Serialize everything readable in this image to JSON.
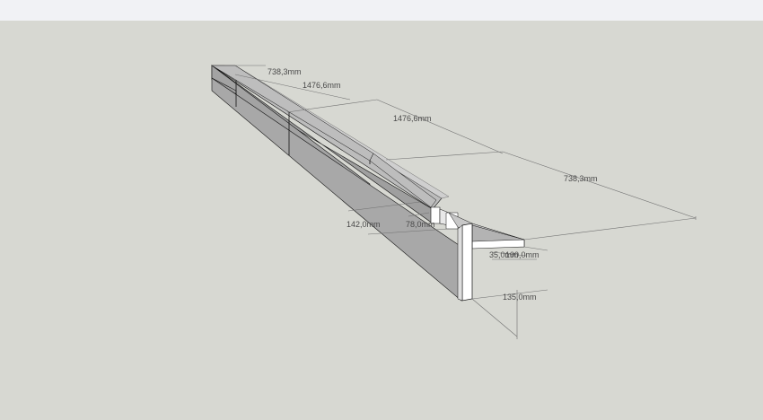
{
  "colors": {
    "background": "#d7d8d2",
    "toolbar": "#f1f2f5",
    "face_dark": "#9f9f9f",
    "face_top": "#bfbfbf",
    "face_light": "#ffffff",
    "edge": "#111111",
    "dimension_line": "#707070",
    "dimension_text": "#4a4a4a"
  },
  "dimensions": {
    "d1": "738,3mm",
    "d2": "1476,6mm",
    "d3": "1476,6mm",
    "d4": "738,3mm",
    "d5": "142,0mm",
    "d6": "78,0mm",
    "d7": "35,0mm",
    "d8": "100,0mm",
    "d9": "135,0mm"
  }
}
